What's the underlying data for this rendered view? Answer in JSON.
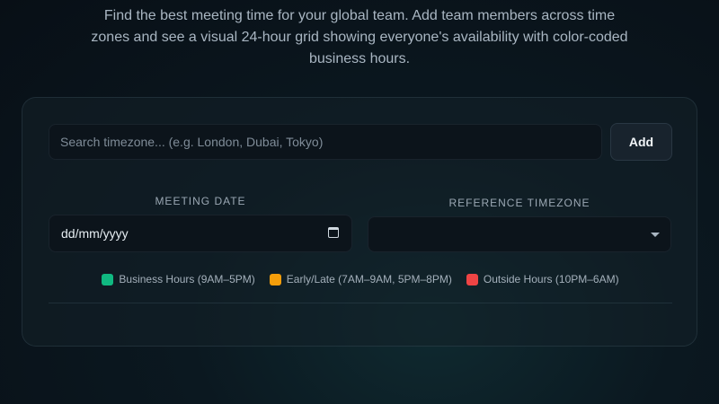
{
  "intro": {
    "text": "Find the best meeting time for your global team. Add team members across time zones and see a visual 24-hour grid showing everyone's availability with color-coded business hours."
  },
  "search": {
    "placeholder": "Search timezone... (e.g. London, Dubai, Tokyo)",
    "value": "",
    "add_label": "Add"
  },
  "meeting_date": {
    "label": "MEETING DATE",
    "value": "dd/mm/yyyy",
    "icon": "calendar-icon"
  },
  "reference_timezone": {
    "label": "REFERENCE TIMEZONE",
    "selected": "",
    "icon": "chevron-down-icon"
  },
  "legend": {
    "items": [
      {
        "label": "Business Hours (9AM–5PM)",
        "color": "#10b981"
      },
      {
        "label": "Early/Late (7AM–9AM, 5PM–8PM)",
        "color": "#f59e0b"
      },
      {
        "label": "Outside Hours (10PM–6AM)",
        "color": "#ef4444"
      }
    ]
  }
}
